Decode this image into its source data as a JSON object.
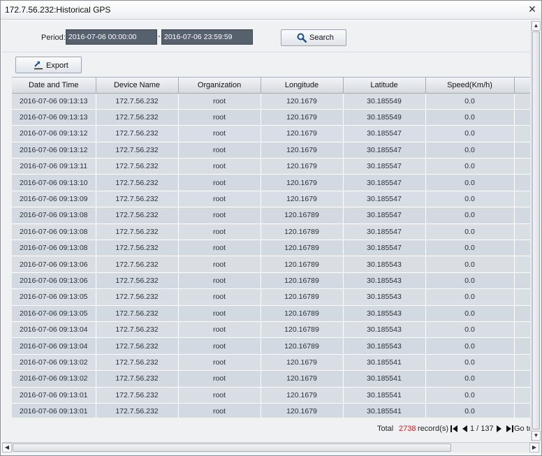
{
  "window": {
    "title": "172.7.56.232:Historical GPS",
    "close_glyph": "✕"
  },
  "query": {
    "period_label": "Period:",
    "start": "2016-07-06 00:00:00",
    "separator": "-",
    "end": "2016-07-06 23:59:59",
    "search_label": "Search",
    "search_icon": "magnifier-icon",
    "export_label": "Export",
    "export_icon": "export-arrow-icon"
  },
  "table": {
    "columns": [
      "Date and Time",
      "Device Name",
      "Organization",
      "Longitude",
      "Latitude",
      "Speed(Km/h)",
      ""
    ],
    "rows": [
      [
        "2016-07-06 09:13:13",
        "172.7.56.232",
        "root",
        "120.1679",
        "30.185549",
        "0.0",
        ""
      ],
      [
        "2016-07-06 09:13:13",
        "172.7.56.232",
        "root",
        "120.1679",
        "30.185549",
        "0.0",
        ""
      ],
      [
        "2016-07-06 09:13:12",
        "172.7.56.232",
        "root",
        "120.1679",
        "30.185547",
        "0.0",
        ""
      ],
      [
        "2016-07-06 09:13:12",
        "172.7.56.232",
        "root",
        "120.1679",
        "30.185547",
        "0.0",
        ""
      ],
      [
        "2016-07-06 09:13:11",
        "172.7.56.232",
        "root",
        "120.1679",
        "30.185547",
        "0.0",
        ""
      ],
      [
        "2016-07-06 09:13:10",
        "172.7.56.232",
        "root",
        "120.1679",
        "30.185547",
        "0.0",
        ""
      ],
      [
        "2016-07-06 09:13:09",
        "172.7.56.232",
        "root",
        "120.1679",
        "30.185547",
        "0.0",
        ""
      ],
      [
        "2016-07-06 09:13:08",
        "172.7.56.232",
        "root",
        "120.16789",
        "30.185547",
        "0.0",
        ""
      ],
      [
        "2016-07-06 09:13:08",
        "172.7.56.232",
        "root",
        "120.16789",
        "30.185547",
        "0.0",
        ""
      ],
      [
        "2016-07-06 09:13:08",
        "172.7.56.232",
        "root",
        "120.16789",
        "30.185547",
        "0.0",
        ""
      ],
      [
        "2016-07-06 09:13:06",
        "172.7.56.232",
        "root",
        "120.16789",
        "30.185543",
        "0.0",
        ""
      ],
      [
        "2016-07-06 09:13:06",
        "172.7.56.232",
        "root",
        "120.16789",
        "30.185543",
        "0.0",
        ""
      ],
      [
        "2016-07-06 09:13:05",
        "172.7.56.232",
        "root",
        "120.16789",
        "30.185543",
        "0.0",
        ""
      ],
      [
        "2016-07-06 09:13:05",
        "172.7.56.232",
        "root",
        "120.16789",
        "30.185543",
        "0.0",
        ""
      ],
      [
        "2016-07-06 09:13:04",
        "172.7.56.232",
        "root",
        "120.16789",
        "30.185543",
        "0.0",
        ""
      ],
      [
        "2016-07-06 09:13:04",
        "172.7.56.232",
        "root",
        "120.16789",
        "30.185543",
        "0.0",
        ""
      ],
      [
        "2016-07-06 09:13:02",
        "172.7.56.232",
        "root",
        "120.1679",
        "30.185541",
        "0.0",
        ""
      ],
      [
        "2016-07-06 09:13:02",
        "172.7.56.232",
        "root",
        "120.1679",
        "30.185541",
        "0.0",
        ""
      ],
      [
        "2016-07-06 09:13:01",
        "172.7.56.232",
        "root",
        "120.1679",
        "30.185541",
        "0.0",
        ""
      ],
      [
        "2016-07-06 09:13:01",
        "172.7.56.232",
        "root",
        "120.1679",
        "30.185541",
        "0.0",
        ""
      ]
    ]
  },
  "pager": {
    "total_label": "Total",
    "total_count": "2738",
    "records_label": "record(s)",
    "page_info": "1 / 137",
    "goto_label": "Go to",
    "first_icon": "first-page-icon",
    "prev_icon": "prev-page-icon",
    "next_icon": "next-page-icon",
    "last_icon": "last-page-icon"
  },
  "scrollbars": {
    "up_glyph": "▲",
    "down_glyph": "▼",
    "left_glyph": "◀",
    "right_glyph": "▶"
  },
  "colors": {
    "total_count": "#d02020",
    "date_input_bg": "#57616d"
  }
}
